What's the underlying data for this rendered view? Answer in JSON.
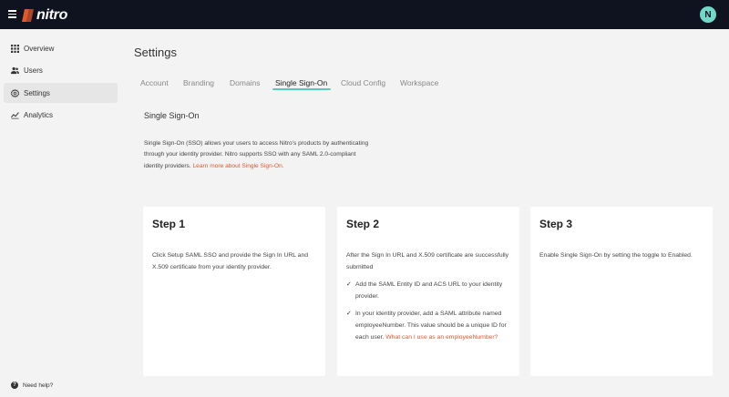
{
  "header": {
    "logo_text": "nitro",
    "avatar_initial": "N"
  },
  "sidebar": {
    "items": [
      {
        "label": "Overview",
        "icon": "grid-icon"
      },
      {
        "label": "Users",
        "icon": "users-icon"
      },
      {
        "label": "Settings",
        "icon": "gear-icon",
        "active": true
      },
      {
        "label": "Analytics",
        "icon": "chart-icon"
      }
    ],
    "help_label": "Need help?"
  },
  "page": {
    "title": "Settings",
    "tabs": [
      "Account",
      "Branding",
      "Domains",
      "Single Sign-On",
      "Cloud Config",
      "Workspace"
    ],
    "active_tab": "Single Sign-On"
  },
  "sso": {
    "title": "Single Sign-On",
    "intro_text": "Single Sign-On (SSO) allows your users to access Nitro’s products by authenticating through your identity provider. Nitro supports SSO with any SAML 2.0-compliant identity providers. ",
    "intro_link": "Learn more about Single Sign-On."
  },
  "steps": [
    {
      "title": "Step 1",
      "text": "Click Setup SAML SSO and provide the Sign In URL and X.509 certificate from your identity provider."
    },
    {
      "title": "Step 2",
      "text": "After the Sign In URL and X.509 certificate are successfully submitted",
      "checks": [
        {
          "text": "Add the SAML Entity ID and ACS URL to your identity provider."
        },
        {
          "text": "In your identity provider, add a SAML attribute named employeeNumber. This value should be a unique ID for each user. ",
          "link": "What can I use as an employeeNumber?"
        }
      ]
    },
    {
      "title": "Step 3",
      "text": "Enable Single Sign-On by setting the toggle to Enabled."
    }
  ],
  "colors": {
    "topbar": "#0f1320",
    "accent": "#5fc9b7",
    "link": "#e0582b",
    "logo": "#e0582b"
  }
}
